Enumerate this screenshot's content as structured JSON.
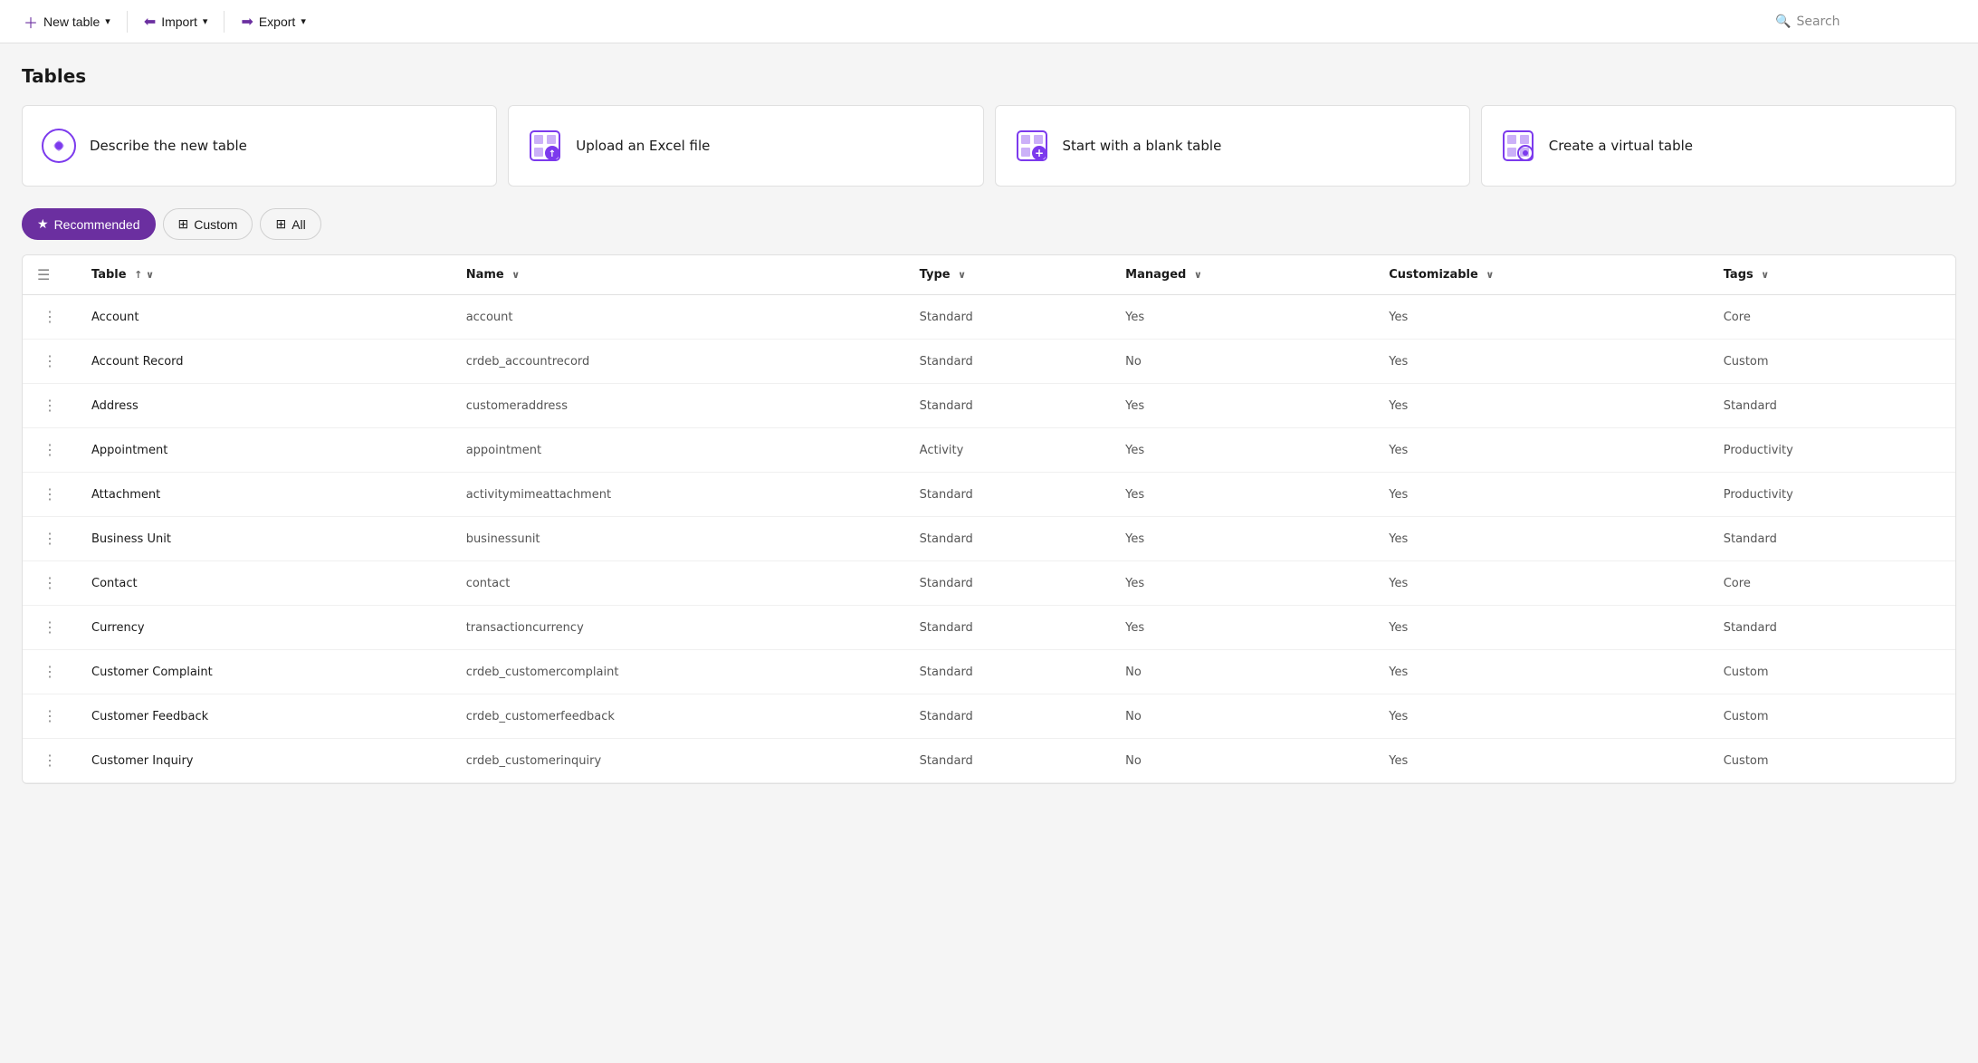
{
  "toolbar": {
    "new_table_label": "New table",
    "import_label": "Import",
    "export_label": "Export",
    "search_placeholder": "Search"
  },
  "page": {
    "title": "Tables"
  },
  "action_cards": [
    {
      "id": "describe",
      "label": "Describe the new table",
      "icon": "ai-icon"
    },
    {
      "id": "upload",
      "label": "Upload an Excel file",
      "icon": "excel-icon"
    },
    {
      "id": "blank",
      "label": "Start with a blank table",
      "icon": "blank-table-icon"
    },
    {
      "id": "virtual",
      "label": "Create a virtual table",
      "icon": "virtual-icon"
    }
  ],
  "filters": [
    {
      "id": "recommended",
      "label": "Recommended",
      "active": true
    },
    {
      "id": "custom",
      "label": "Custom",
      "active": false
    },
    {
      "id": "all",
      "label": "All",
      "active": false
    }
  ],
  "table": {
    "columns": [
      {
        "id": "name",
        "label": "Table",
        "sort": "asc"
      },
      {
        "id": "logical",
        "label": "Name",
        "sort": "none"
      },
      {
        "id": "type",
        "label": "Type",
        "sort": "none"
      },
      {
        "id": "managed",
        "label": "Managed",
        "sort": "none"
      },
      {
        "id": "customizable",
        "label": "Customizable",
        "sort": "none"
      },
      {
        "id": "tags",
        "label": "Tags",
        "sort": "none"
      }
    ],
    "rows": [
      {
        "name": "Account",
        "logical": "account",
        "type": "Standard",
        "managed": "Yes",
        "customizable": "Yes",
        "tags": "Core"
      },
      {
        "name": "Account Record",
        "logical": "crdeb_accountrecord",
        "type": "Standard",
        "managed": "No",
        "customizable": "Yes",
        "tags": "Custom"
      },
      {
        "name": "Address",
        "logical": "customeraddress",
        "type": "Standard",
        "managed": "Yes",
        "customizable": "Yes",
        "tags": "Standard"
      },
      {
        "name": "Appointment",
        "logical": "appointment",
        "type": "Activity",
        "managed": "Yes",
        "customizable": "Yes",
        "tags": "Productivity"
      },
      {
        "name": "Attachment",
        "logical": "activitymimeattachment",
        "type": "Standard",
        "managed": "Yes",
        "customizable": "Yes",
        "tags": "Productivity"
      },
      {
        "name": "Business Unit",
        "logical": "businessunit",
        "type": "Standard",
        "managed": "Yes",
        "customizable": "Yes",
        "tags": "Standard"
      },
      {
        "name": "Contact",
        "logical": "contact",
        "type": "Standard",
        "managed": "Yes",
        "customizable": "Yes",
        "tags": "Core"
      },
      {
        "name": "Currency",
        "logical": "transactioncurrency",
        "type": "Standard",
        "managed": "Yes",
        "customizable": "Yes",
        "tags": "Standard"
      },
      {
        "name": "Customer Complaint",
        "logical": "crdeb_customercomplaint",
        "type": "Standard",
        "managed": "No",
        "customizable": "Yes",
        "tags": "Custom"
      },
      {
        "name": "Customer Feedback",
        "logical": "crdeb_customerfeedback",
        "type": "Standard",
        "managed": "No",
        "customizable": "Yes",
        "tags": "Custom"
      },
      {
        "name": "Customer Inquiry",
        "logical": "crdeb_customerinquiry",
        "type": "Standard",
        "managed": "No",
        "customizable": "Yes",
        "tags": "Custom"
      }
    ]
  }
}
